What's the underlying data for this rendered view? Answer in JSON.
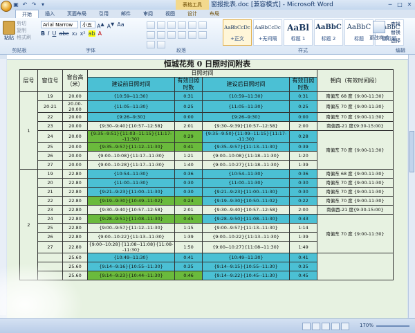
{
  "window": {
    "title": "窗报批表.doc [兼容模式] - Microsoft Word",
    "context_tab": "表格工具"
  },
  "tabs": [
    "开始",
    "插入",
    "页面布局",
    "引用",
    "邮件",
    "审阅",
    "视图",
    "设计",
    "布局"
  ],
  "ribbon": {
    "groups": [
      "剪贴板",
      "字体",
      "段落",
      "样式",
      "编辑"
    ],
    "paste_label": "粘贴",
    "clipboard_small": [
      "剪切",
      "复制",
      "格式刷"
    ],
    "font_name": "Arial Narrow",
    "font_size": "小五",
    "styles": [
      {
        "sample": "AaBbCcDc",
        "name": "+正文"
      },
      {
        "sample": "AaBbCcDc",
        "name": "+无间隔"
      },
      {
        "sample": "AaBl",
        "name": "标题 1"
      },
      {
        "sample": "AaBbC",
        "name": "标题 2"
      },
      {
        "sample": "AaBbC",
        "name": "标题"
      },
      {
        "sample": "AaBbC",
        "name": "副标题"
      }
    ],
    "change_styles": "更改样式",
    "edit_items": [
      "查找",
      "替换",
      "选择"
    ]
  },
  "document": {
    "heading": "恒城花苑 0 日照时间附表",
    "headers": {
      "floor": "层号",
      "window": "窗位号",
      "sill": "窗台高（米）",
      "sun_time": "日照时间",
      "before": "建设前日照时间",
      "before_eff": "有效日照时数",
      "after": "建设后日照时间",
      "after_eff": "有效日照时数",
      "orient": "朝向（有效时间段）"
    },
    "floors": [
      {
        "floor": "1",
        "rows": [
          {
            "win": "19",
            "sill": "20.00",
            "before": "{10:59--11:30}",
            "before_eff": "0:31",
            "after": "{10:59--11:30}",
            "after_eff": "0:31",
            "colors": [
              "cyan",
              "cyan",
              "cyan",
              "cyan"
            ]
          },
          {
            "win": "20-21",
            "sill": "20.00-20.00",
            "before": "{11:05--11:30}",
            "before_eff": "0:25",
            "after": "{11:05--11:30}",
            "after_eff": "0:25",
            "colors": [
              "cyan",
              "cyan",
              "cyan",
              "cyan"
            ]
          },
          {
            "win": "22",
            "sill": "20.00",
            "before": "{9:26--9:30}",
            "before_eff": "0:00",
            "after": "{9:26--9:30}",
            "after_eff": "0:00",
            "colors": [
              "cyan",
              "cyan",
              "cyan",
              "cyan"
            ]
          },
          {
            "win": "23",
            "sill": "20.00",
            "before": "{9:30--9:40}{10:57--12:58}",
            "before_eff": "2:01",
            "after": "{9:30--9:39}{10:57--12:58}",
            "after_eff": "2:00",
            "colors": [
              "light",
              "light",
              "light",
              "light"
            ]
          },
          {
            "win": "24",
            "sill": "20.00",
            "before": "{9:35--9:51}{11:03--11:15}{11:17--11:30}",
            "before_eff": "0:29",
            "after": "{9:35--9:50}{11:09--11:15}{11:17--11:30}",
            "after_eff": "0:28",
            "colors": [
              "green",
              "green",
              "cyan",
              "cyan"
            ]
          },
          {
            "win": "25",
            "sill": "20.00",
            "before": "{9:35--9:57}{11:12--11:30}",
            "before_eff": "0:41",
            "after": "{9:35--9:57}{11:13--11:30}",
            "after_eff": "0:39",
            "colors": [
              "green",
              "green",
              "cyan",
              "cyan"
            ]
          },
          {
            "win": "26",
            "sill": "20.00",
            "before": "{9:00--10:08}{11:17--11:30}",
            "before_eff": "1:21",
            "after": "{9:00--10:08}{11:18--11:30}",
            "after_eff": "1:20",
            "colors": [
              "light",
              "light",
              "light",
              "light"
            ]
          },
          {
            "win": "27",
            "sill": "20.00",
            "before": "{9:00--10:28}{11:17--11:30}",
            "before_eff": "1:40",
            "after": "{9:00--10:27}{11:18--11:30}",
            "after_eff": "1:39",
            "colors": [
              "light",
              "light",
              "light",
              "light"
            ]
          }
        ],
        "orients": [
          {
            "text": "南偏东 68 度 {9:00-11:30}",
            "span": 1
          },
          {
            "text": "南偏东 70 度 {9:00-11:30}",
            "span": 1
          },
          {
            "text": "南偏东 70 度 {9:00-11:30}",
            "span": 1
          },
          {
            "text": "南偏西-21 度{9:30-15:00}",
            "span": 1
          },
          {
            "text": "南偏东 70 度 {9:00-11:30}",
            "span": 4
          }
        ]
      },
      {
        "floor": "2",
        "rows": [
          {
            "win": "19",
            "sill": "22.80",
            "before": "{10:54--11:30}",
            "before_eff": "0:36",
            "after": "{10:54--11:30}",
            "after_eff": "0:36",
            "colors": [
              "cyan",
              "cyan",
              "cyan",
              "cyan"
            ]
          },
          {
            "win": "20",
            "sill": "22.80",
            "before": "{11:00--11:30}",
            "before_eff": "0:30",
            "after": "{11:00--11:30}",
            "after_eff": "0:30",
            "colors": [
              "cyan",
              "cyan",
              "cyan",
              "cyan"
            ]
          },
          {
            "win": "21",
            "sill": "22.80",
            "before": "{9:21--9:23}{11:00--11:30}",
            "before_eff": "0:30",
            "after": "{9:21--9:23}{11:00--11:30}",
            "after_eff": "0:30",
            "colors": [
              "cyan",
              "cyan",
              "cyan",
              "cyan"
            ]
          },
          {
            "win": "22",
            "sill": "22.80",
            "before": "{9:19--9:30}{10:49--11:02}",
            "before_eff": "0:24",
            "after": "{9:19--9:30}{10:50--11:02}",
            "after_eff": "0:22",
            "colors": [
              "green",
              "green",
              "cyan",
              "cyan"
            ]
          },
          {
            "win": "23",
            "sill": "22.80",
            "before": "{9:30--9:40}{10:57--12:58}",
            "before_eff": "2:01",
            "after": "{9:30--9:40}{10:57--12:58}",
            "after_eff": "2:00",
            "colors": [
              "light",
              "light",
              "light",
              "light"
            ]
          },
          {
            "win": "24",
            "sill": "22.80",
            "before": "{9:28--9:51}{11:08--11:30}",
            "before_eff": "0:45",
            "after": "{9:28--9:50}{11:08--11:30}",
            "after_eff": "0:43",
            "colors": [
              "green",
              "green",
              "cyan",
              "cyan"
            ]
          },
          {
            "win": "25",
            "sill": "22.80",
            "before": "{9:00--9:57}{11:12--11:30}",
            "before_eff": "1:15",
            "after": "{9:00--9:57}{11:13--11:30}",
            "after_eff": "1:14",
            "colors": [
              "light",
              "light",
              "light",
              "light"
            ]
          },
          {
            "win": "26",
            "sill": "22.80",
            "before": "{9:00--10:22}{11:13--11:30}",
            "before_eff": "1:39",
            "after": "{9:00--10:22}{11:13--11:30}",
            "after_eff": "1:39",
            "colors": [
              "light",
              "light",
              "light",
              "light"
            ]
          },
          {
            "win": "27",
            "sill": "22.80",
            "before": "{9:00--10:28}{11:08--11:08}{11:08--11:30}",
            "before_eff": "1:50",
            "after": "{9:00--10:27}{11:08--11:30}",
            "after_eff": "1:49",
            "colors": [
              "light",
              "light",
              "light",
              "light"
            ]
          },
          {
            "win": "",
            "sill": "25.60",
            "before": "{10:49--11:30}",
            "before_eff": "0:41",
            "after": "{10:49--11:30}",
            "after_eff": "0:41",
            "colors": [
              "cyan",
              "cyan",
              "cyan",
              "cyan"
            ]
          },
          {
            "win": "",
            "sill": "25.60",
            "before": "{9:14--9:16}{10:55--11:30}",
            "before_eff": "0:35",
            "after": "{9:14--9:15}{10:55--11:30}",
            "after_eff": "0:35",
            "colors": [
              "cyan",
              "cyan",
              "cyan",
              "cyan"
            ]
          },
          {
            "win": "",
            "sill": "25.60",
            "before": "{9:14--9:23}{10:44--11:30}",
            "before_eff": "0:46",
            "after": "{9:14--9:22}{10:45--11:30}",
            "after_eff": "0:45",
            "colors": [
              "green",
              "green",
              "cyan",
              "cyan"
            ]
          }
        ],
        "orients": [
          {
            "text": "南偏东 68 度 {9:00-11:30}",
            "span": 1
          },
          {
            "text": "南偏东 70 度 {9:00-11:30}",
            "span": 1
          },
          {
            "text": "南偏东 70 度 {9:00-11:30}",
            "span": 1
          },
          {
            "text": "南偏东 70 度 {9:00-11:30}",
            "span": 1
          },
          {
            "text": "南偏西-21 度{9:30-15:00}",
            "span": 1
          },
          {
            "text": "南偏东 70 度 {9:00-11:30}",
            "span": 4
          },
          {
            "text": "",
            "span": 3
          }
        ]
      }
    ]
  },
  "status": {
    "zoom": "170%"
  },
  "colors": {
    "cyan": "#4bc0d4",
    "green": "#6aba3c",
    "page_bg": "#e7f2e1"
  }
}
